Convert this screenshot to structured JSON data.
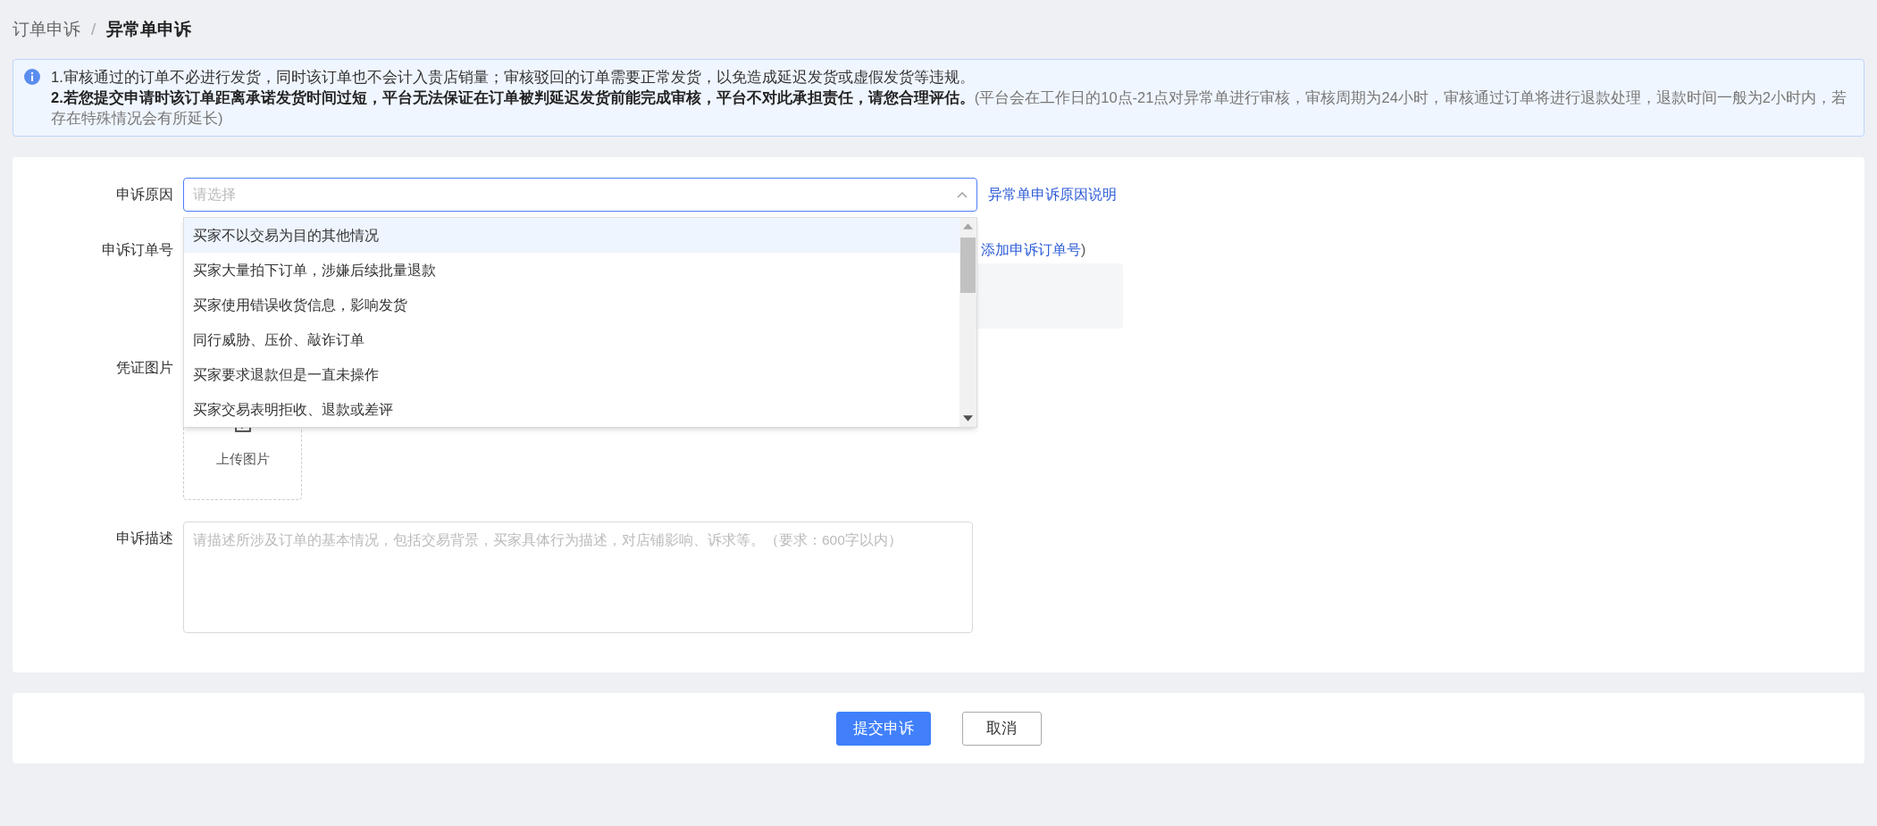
{
  "breadcrumb_separator": "/",
  "breadcrumb": [
    {
      "label": "订单申诉",
      "current": false
    },
    {
      "label": "异常单申诉",
      "current": true
    }
  ],
  "notice": {
    "line_1": "1.审核通过的订单不必进行发货，同时该订单也不会计入贵店销量；审核驳回的订单需要正常发货，以免造成延迟发货或虚假发货等违规。",
    "line_2": "**2.若您提交申请时该订单距离承诺发货时间过短，平台无法保证在订单被判延迟发货前能完成审核，平台不对此承担责任，请您合理评估。**(平台会在工作日的10点-21点对异常单进行审核，审核周期为24小时，审核通过订单将进行退款处理，退款时间一般为2小时内，若存在特殊情况会有所延长)"
  },
  "form": {
    "reason": {
      "label": "申诉原因",
      "placeholder": "请选择",
      "expanded": true,
      "link": "异常单申诉原因说明",
      "options": [
        {
          "label": "买家不以交易为目的其他情况",
          "highlighted": true
        },
        {
          "label": "买家大量拍下订单，涉嫌后续批量退款",
          "highlighted": false
        },
        {
          "label": "买家使用错误收货信息，影响发货",
          "highlighted": false
        },
        {
          "label": "同行威胁、压价、敲诈订单",
          "highlighted": false
        },
        {
          "label": "买家要求退款但是一直未操作",
          "highlighted": false
        },
        {
          "label": "买家交易表明拒收、退款或差评",
          "highlighted": false
        }
      ]
    },
    "order_number": {
      "label": "申诉订单号",
      "add_link": "添加申诉订单号",
      "add_suffix": ")"
    },
    "images": {
      "label": "凭证图片",
      "upload": "上传图片"
    },
    "description": {
      "label": "申诉描述",
      "placeholder": "请描述所涉及订单的基本情况，包括交易背景，买家具体行为描述，对店铺影响、诉求等。（要求：600字以内）"
    }
  },
  "buttons": [
    {
      "label": "提交申诉",
      "kind": "primary"
    },
    {
      "label": "取消",
      "kind": "default"
    }
  ]
}
